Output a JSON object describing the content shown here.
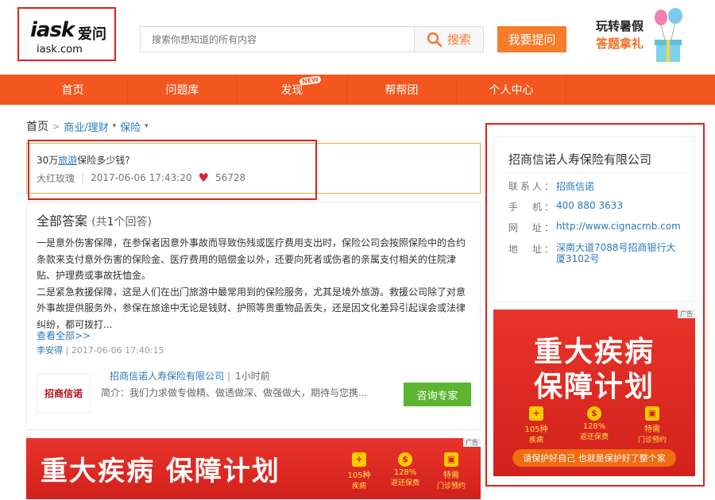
{
  "header": {
    "logo": {
      "mark": "iask",
      "cn": "爱问",
      "url": "iask.com"
    },
    "search_placeholder": "搜索你想知道的所有内容",
    "search_button": "搜索",
    "ask_button": "我要提问",
    "promo": {
      "line1": "玩转暑假",
      "line2": "答题拿礼"
    }
  },
  "nav": {
    "items": [
      "首页",
      "问题库",
      "发现",
      "帮帮团",
      "个人中心"
    ],
    "badge": "NEW"
  },
  "breadcrumb": {
    "home": "首页",
    "level1": "商业/理财",
    "level2": "保险"
  },
  "question": {
    "title_pre": "30万",
    "title_link": "旅游",
    "title_post": "保险多少钱?",
    "author": "大红玫瑰",
    "time": "2017-06-06 17:43:20",
    "likes": "56728"
  },
  "answers": {
    "title": "全部答案",
    "count_pre": "(共",
    "count": "1",
    "count_post": "个回答)",
    "body_p1": "一是意外伤害保障，在参保者因意外事故而导致伤残或医疗费用支出时，保险公司会按照保险中的合约条款来支付意外伤害的保险金、医疗费用的赔偿金以外，还要向死者或伤者的亲属支付相关的住院津贴、护理费或事故抚恤金。",
    "body_p2": "二是紧急救援保障，这是人们在出门旅游中最常用到的保险服务，尤其是境外旅游。救援公司除了对意外事故提供服务外，参保在旅途中无论是钱财、护照等贵重物品丢失，还是因文化差异引起误会或法律纠纷，都可拨打...",
    "see_all": "查看全部>>",
    "answer_user": "李安得",
    "answer_time": "2017-06-06 17:40:15",
    "company_logo_text": "招商信诺",
    "company_name": "招商信诺人寿保险有限公司",
    "company_time": "1小时前",
    "company_intro": "简介：我们力求做专做精、做透做深、做强做大，期待与您携...",
    "consult_button": "咨询专家"
  },
  "banner_bottom": {
    "title": "重大疾病 保障计划",
    "ad": "广告",
    "features": [
      {
        "icon": "+",
        "value": "105种",
        "label": "疾病"
      },
      {
        "icon": "$",
        "value": "128%",
        "label": "返还保费"
      },
      {
        "icon": "▣",
        "value": "特需",
        "label": "门诊预约"
      }
    ]
  },
  "company_info": {
    "title": "招商信诺人寿保险有限公司",
    "rows": [
      {
        "key": "联系人：",
        "value": "招商信诺"
      },
      {
        "key": "手　机：",
        "value": "400 880 3633"
      },
      {
        "key": "网　址：",
        "value": "http://www.cignacmb.com"
      },
      {
        "key": "地　址：",
        "value": "深南大道7088号招商银行大厦3102号"
      }
    ]
  },
  "banner_right": {
    "line1": "重大疾病",
    "line2": "保障计划",
    "ad": "广告",
    "slogan": "请保护好自己 也就是保护好了整个家"
  },
  "colors": {
    "accent": "#f3561e",
    "link": "#2a79b8",
    "highlight": "#e02020",
    "green": "#5cb531"
  }
}
